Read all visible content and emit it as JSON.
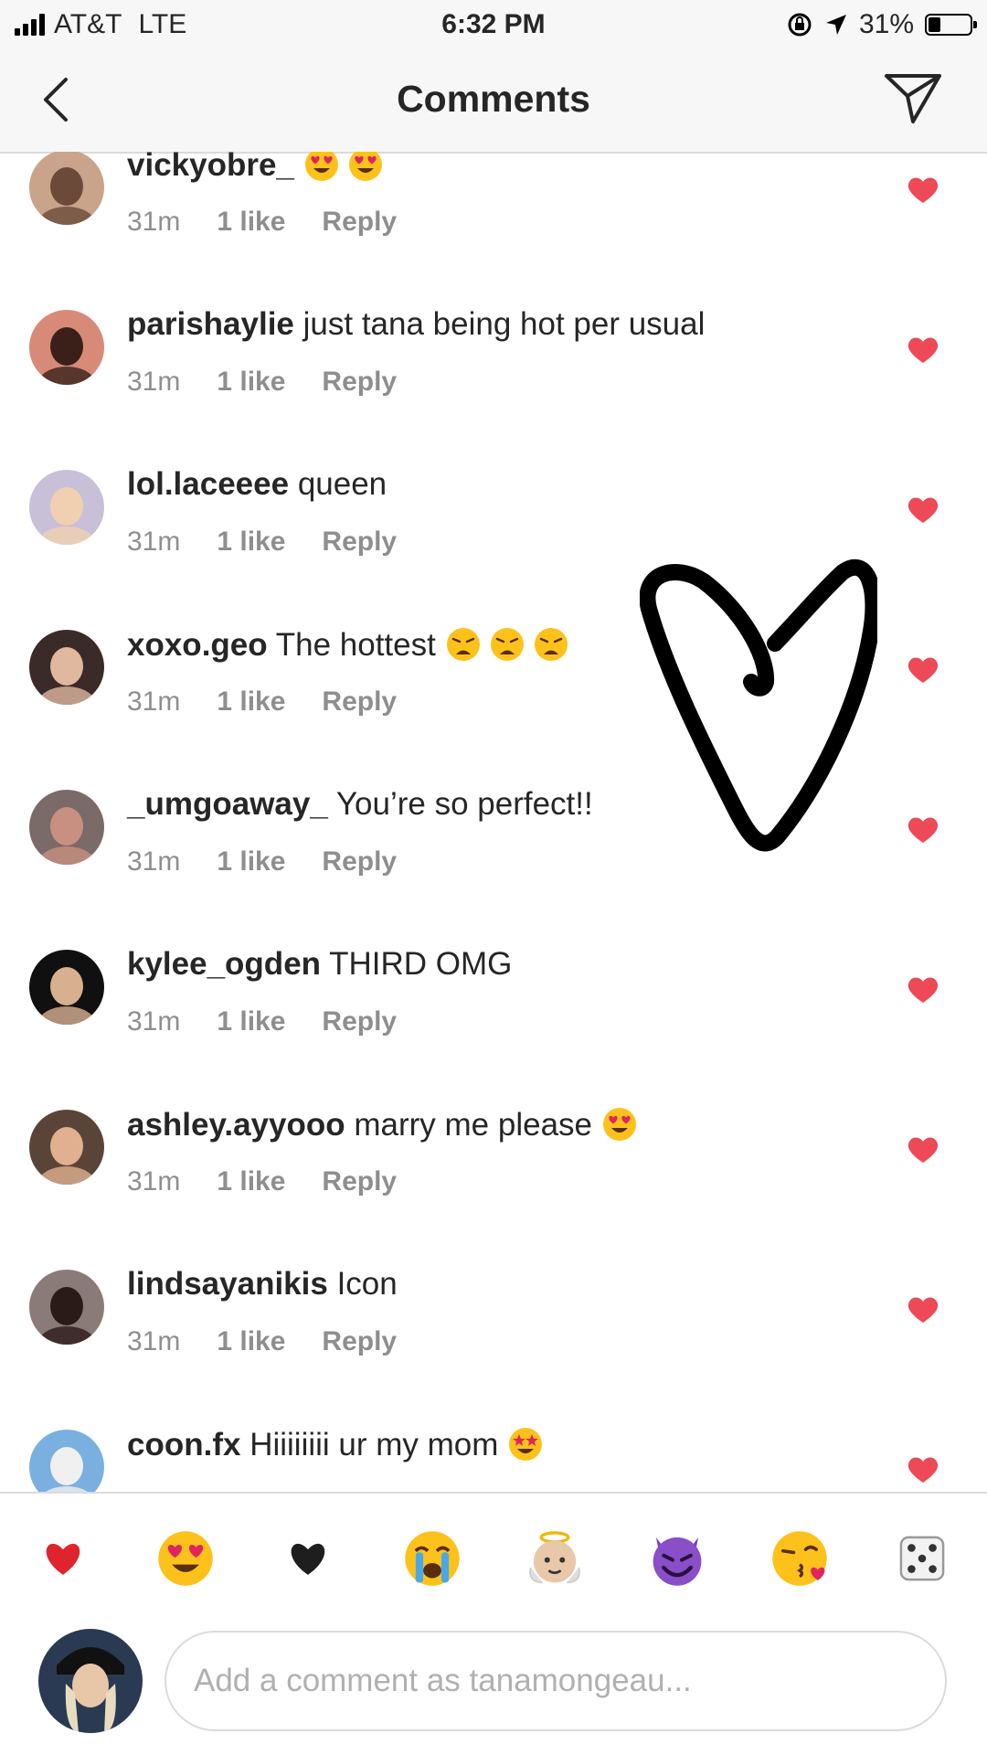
{
  "status_bar": {
    "carrier": "AT&T",
    "network": "LTE",
    "time": "6:32 PM",
    "battery": "31%",
    "battery_level": 0.31
  },
  "header": {
    "title": "Comments"
  },
  "comments": [
    {
      "username": "vickyobre_",
      "text": "",
      "emoji": [
        "heart-eyes",
        "heart-eyes"
      ],
      "time": "31m",
      "likes": "1 like",
      "reply": "Reply"
    },
    {
      "username": "parishaylie",
      "text": "just tana being hot per usual",
      "emoji": [],
      "time": "31m",
      "likes": "1 like",
      "reply": "Reply"
    },
    {
      "username": "lol.laceeee",
      "text": "queen",
      "emoji": [],
      "time": "31m",
      "likes": "1 like",
      "reply": "Reply"
    },
    {
      "username": "xoxo.geo",
      "text": "The hottest",
      "emoji": [
        "weary",
        "weary",
        "weary"
      ],
      "time": "31m",
      "likes": "1 like",
      "reply": "Reply"
    },
    {
      "username": "_umgoaway_",
      "text": "You’re so perfect!!",
      "emoji": [],
      "time": "31m",
      "likes": "1 like",
      "reply": "Reply"
    },
    {
      "username": "kylee_ogden",
      "text": "THIRD OMG",
      "emoji": [],
      "time": "31m",
      "likes": "1 like",
      "reply": "Reply"
    },
    {
      "username": "ashley.ayyooo",
      "text": "marry me please",
      "emoji": [
        "heart-eyes"
      ],
      "time": "31m",
      "likes": "1 like",
      "reply": "Reply"
    },
    {
      "username": "lindsayanikis",
      "text": "Icon",
      "emoji": [],
      "time": "31m",
      "likes": "1 like",
      "reply": "Reply"
    },
    {
      "username": "coon.fx",
      "text": "Hiiiiiiii ur my mom",
      "emoji": [
        "star-struck"
      ],
      "time": "",
      "likes": "",
      "reply": ""
    }
  ],
  "quick_emojis": [
    "red-heart",
    "heart-eyes",
    "black-heart",
    "crying",
    "angel",
    "smiling-devil",
    "kissing-heart",
    "dice"
  ],
  "comment_input": {
    "placeholder": "Add a comment as tanamongeau..."
  },
  "colors": {
    "like_heart": "#ed4956",
    "meta_text": "#8e8e8e",
    "divider": "#dbdbdb"
  }
}
